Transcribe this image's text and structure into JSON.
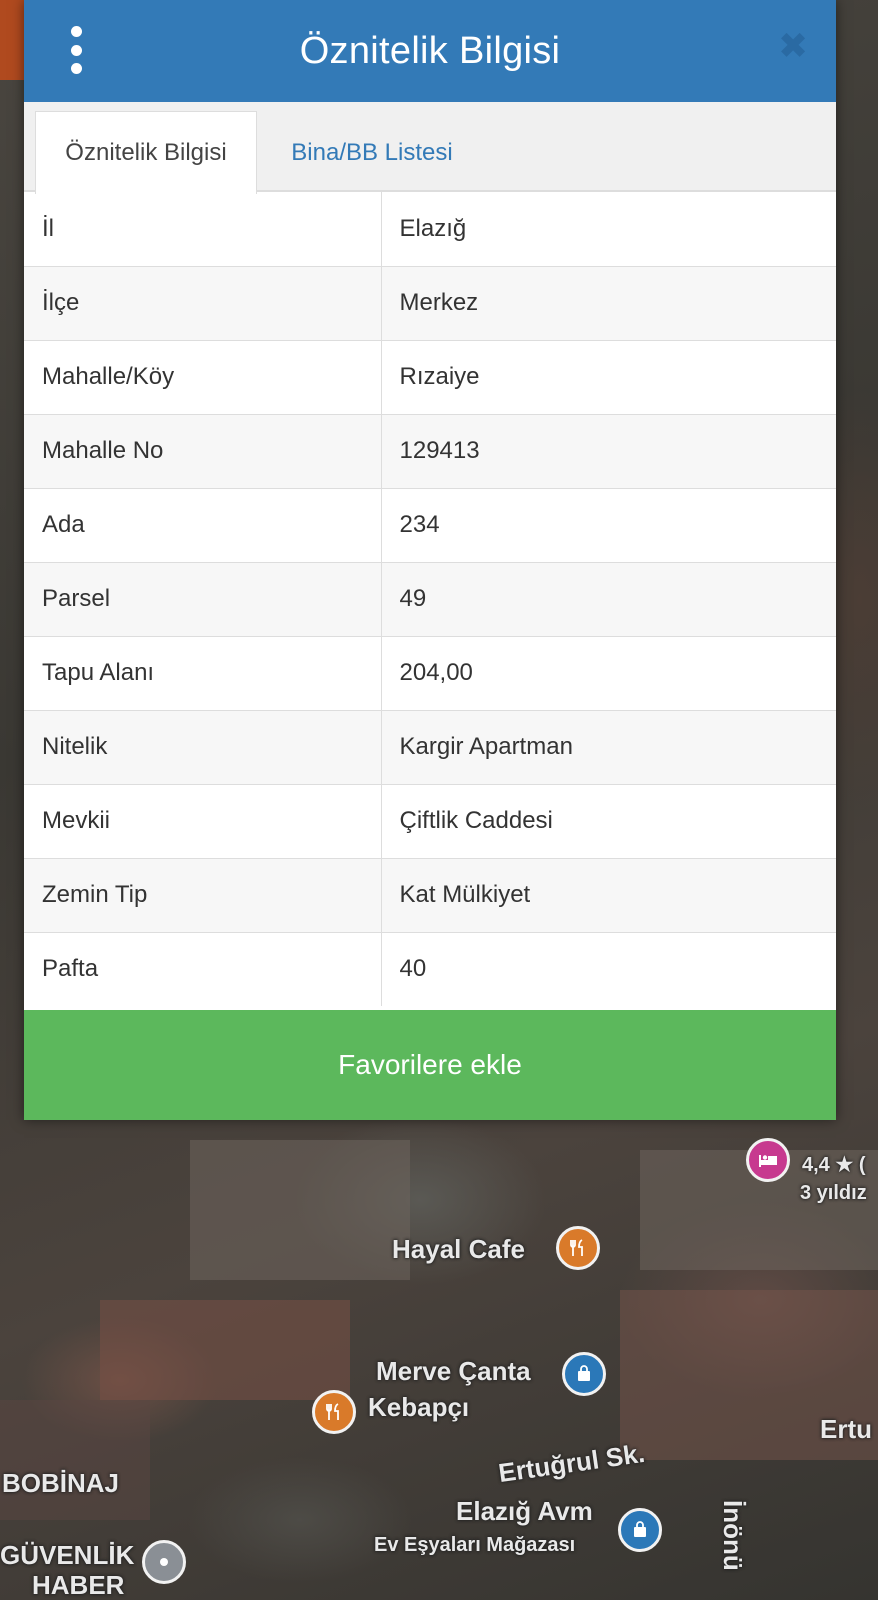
{
  "dialog": {
    "title": "Öznitelik Bilgisi",
    "menu_icon": "more-vertical-icon",
    "close_icon": "close-icon",
    "close_glyph": "✖"
  },
  "tabs": [
    {
      "label": "Öznitelik Bilgisi",
      "active": true
    },
    {
      "label": "Bina/BB Listesi",
      "active": false
    }
  ],
  "attributes": [
    {
      "key": "İl",
      "value": "Elazığ"
    },
    {
      "key": "İlçe",
      "value": "Merkez"
    },
    {
      "key": "Mahalle/Köy",
      "value": "Rızaiye"
    },
    {
      "key": "Mahalle No",
      "value": "129413"
    },
    {
      "key": "Ada",
      "value": "234"
    },
    {
      "key": "Parsel",
      "value": "49"
    },
    {
      "key": "Tapu Alanı",
      "value": "204,00"
    },
    {
      "key": "Nitelik",
      "value": "Kargir Apartman"
    },
    {
      "key": "Mevkii",
      "value": "Çiftlik Caddesi"
    },
    {
      "key": "Zemin Tip",
      "value": "Kat Mülkiyet"
    },
    {
      "key": "Pafta",
      "value": "40"
    }
  ],
  "favorite_button": {
    "label": "Favorilere ekle"
  },
  "map": {
    "labels": {
      "hayal_cafe": "Hayal Cafe",
      "merve_canta": "Merve Çanta",
      "kebapci": "Kebapçı",
      "ertugrul_sk": "Ertuğrul Sk.",
      "elazig_avm": "Elazığ Avm",
      "ev_esyalari": "Ev Eşyaları Mağazası",
      "bobinaj": "BOBİNAJ",
      "guvenlik": "GÜVENLİK",
      "haber": "HABER",
      "inonu": "İnönü",
      "ertu": "Ertu",
      "rating": "4,4 ★ (",
      "stars": "3 yıldız"
    },
    "icons": {
      "restaurant": "restaurant-icon",
      "shopping": "shopping-bag-icon",
      "hotel": "hotel-icon",
      "location": "location-pin-icon"
    },
    "colors": {
      "restaurant_pin": "#d97a2a",
      "shop_pin": "#2b78b8",
      "hotel_pin": "#c7398f"
    }
  },
  "colors": {
    "header": "#337ab7",
    "favorite": "#5cb85c",
    "tab_link": "#337ab7"
  }
}
